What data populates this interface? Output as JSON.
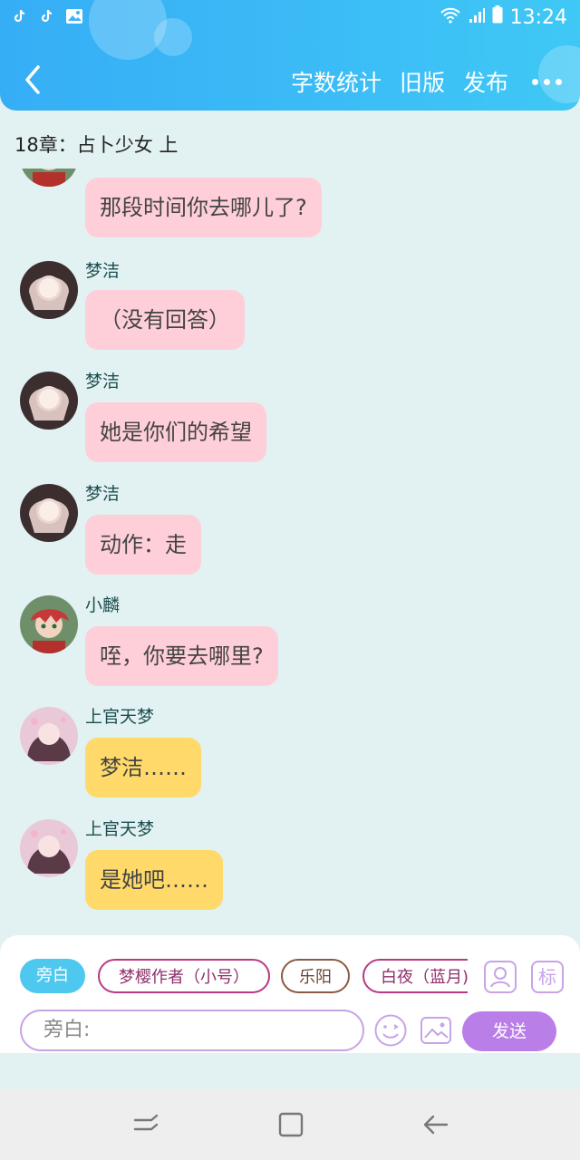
{
  "status": {
    "time": "13:24"
  },
  "nav": {
    "word_count": "字数统计",
    "old_version": "旧版",
    "publish": "发布"
  },
  "chapter_title": "18章：占卜少女  上",
  "messages": [
    {
      "name": "",
      "text": "那段时间你去哪儿了?",
      "color": "pink",
      "avatar": "boy-red"
    },
    {
      "name": "梦洁",
      "text": "（没有回答）",
      "color": "pink",
      "avatar": "girl-white"
    },
    {
      "name": "梦洁",
      "text": "她是你们的希望",
      "color": "pink",
      "avatar": "girl-white"
    },
    {
      "name": "梦洁",
      "text": "动作：走",
      "color": "pink",
      "avatar": "girl-white"
    },
    {
      "name": "小麟",
      "text": "咥，你要去哪里?",
      "color": "pink",
      "avatar": "boy-red"
    },
    {
      "name": "上官天梦",
      "text": "梦洁……",
      "color": "yellow",
      "avatar": "girl-pink"
    },
    {
      "name": "上官天梦",
      "text": "是她吧……",
      "color": "yellow",
      "avatar": "girl-pink"
    }
  ],
  "composer": {
    "chips": [
      "旁白",
      "梦樱作者（小号）",
      "乐阳",
      "白夜（蓝月)"
    ],
    "tag_button": "标",
    "placeholder": "旁白:",
    "send": "发送"
  },
  "colors": {
    "header": "#36aef6",
    "pink_bubble": "#ffcfd9",
    "yellow_bubble": "#ffda6b",
    "send": "#b97ee8"
  }
}
